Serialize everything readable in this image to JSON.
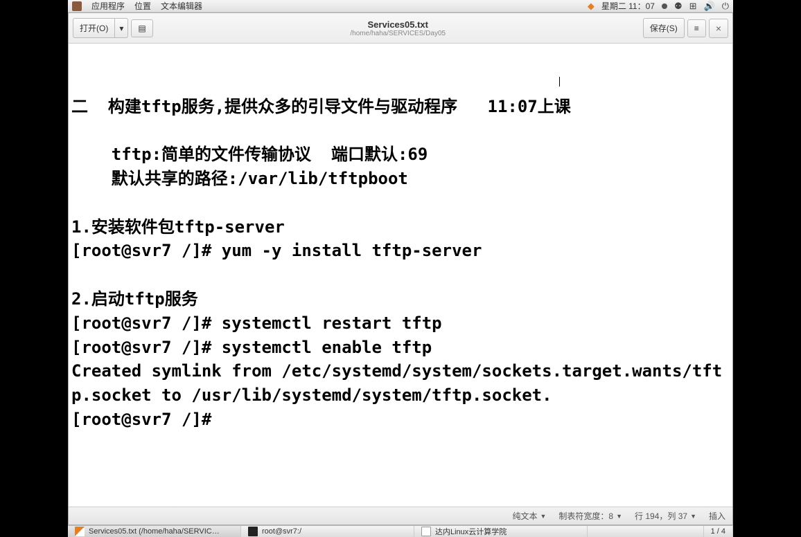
{
  "top_panel": {
    "apps": "应用程序",
    "places": "位置",
    "app_name": "文本编辑器",
    "clock": "星期二 11：07"
  },
  "toolbar": {
    "open_label": "打开(O)",
    "save_label": "保存(S)"
  },
  "title": {
    "filename": "Services05.txt",
    "filepath": "/home/haha/SERVICES/Day05"
  },
  "document_text": "二  构建tftp服务,提供众多的引导文件与驱动程序   11:07上课\n\n    tftp:简单的文件传输协议  端口默认:69\n    默认共享的路径:/var/lib/tftpboot\n\n1.安装软件包tftp-server\n[root@svr7 /]# yum -y install tftp-server\n\n2.启动tftp服务\n[root@svr7 /]# systemctl restart tftp\n[root@svr7 /]# systemctl enable tftp\nCreated symlink from /etc/systemd/system/sockets.target.wants/tftp.socket to /usr/lib/systemd/system/tftp.socket.\n[root@svr7 /]# \n",
  "statusbar": {
    "syntax": "纯文本",
    "tab_width": "制表符宽度：8",
    "position": "行 194，列 37",
    "mode": "插入",
    "page": "1 / 4"
  },
  "taskbar": {
    "item1": "Services05.txt (/home/haha/SERVIC…",
    "item2": "root@svr7:/",
    "item3": "达内Linux云计算学院"
  }
}
